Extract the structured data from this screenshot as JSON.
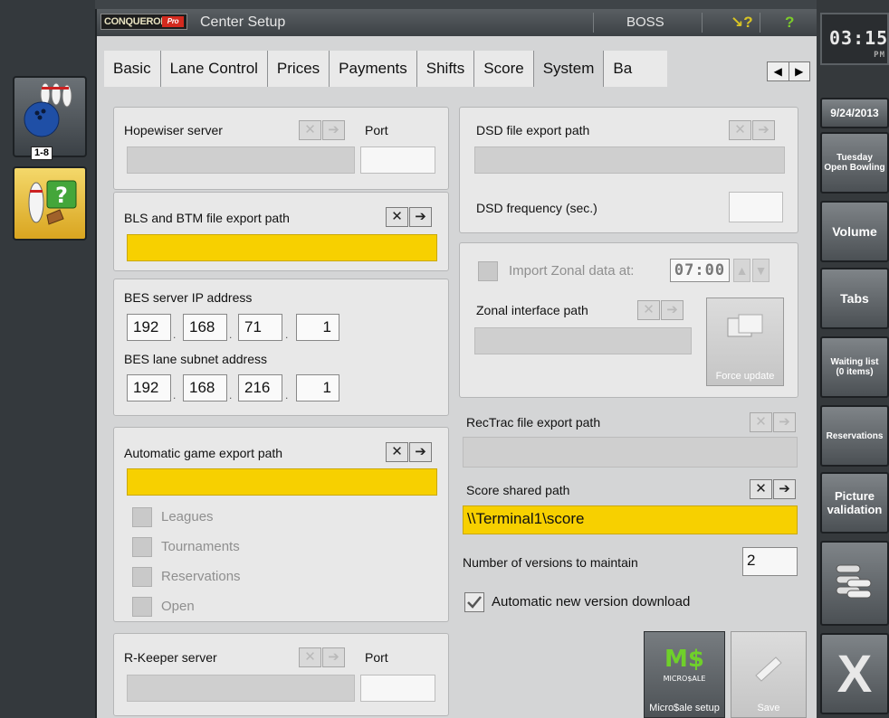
{
  "left": {
    "lanes_badge": "1-8"
  },
  "titlebar": {
    "brand": "CONQUEROR",
    "brand_pro": "Pro",
    "title": "Center Setup",
    "user": "BOSS",
    "icons": [
      "help-pointer-icon",
      "help-icon"
    ]
  },
  "tabs": [
    "Basic",
    "Lane Control",
    "Prices",
    "Payments",
    "Shifts",
    "Score",
    "System",
    "Ba"
  ],
  "tab_scroll": {
    "prev": "◀",
    "next": "▶"
  },
  "hopewiser": {
    "label": "Hopewiser server",
    "port_label": "Port",
    "server": "",
    "port": ""
  },
  "bls": {
    "label": "BLS and BTM file export path",
    "value": ""
  },
  "bes": {
    "ip_label": "BES server IP address",
    "ip": [
      "192",
      "168",
      "71",
      "1"
    ],
    "subnet_label": "BES lane subnet address",
    "subnet": [
      "192",
      "168",
      "216",
      "1"
    ]
  },
  "auto_export": {
    "label": "Automatic game export path",
    "value": "",
    "options": [
      "Leagues",
      "Tournaments",
      "Reservations",
      "Open"
    ]
  },
  "rkeeper": {
    "label": "R-Keeper server",
    "port_label": "Port",
    "server": "",
    "port": ""
  },
  "dsd": {
    "path_label": "DSD file export path",
    "path": "",
    "freq_label": "DSD frequency (sec.)",
    "freq": ""
  },
  "zonal": {
    "import_label": "Import Zonal data at:",
    "time": "07:00",
    "path_label": "Zonal interface path",
    "path": "",
    "force_update": "Force update"
  },
  "rectrac": {
    "label": "RecTrac file export path",
    "value": ""
  },
  "score_shared": {
    "label": "Score shared path",
    "value": "\\\\Terminal1\\score"
  },
  "versions": {
    "label": "Number of versions to maintain",
    "value": "2"
  },
  "auto_download": {
    "label": "Automatic new version download",
    "checked": true
  },
  "bottom_buttons": {
    "microsale": "Micro$ale setup",
    "save": "Save"
  },
  "right": {
    "time": "03:15",
    "ampm": "PM",
    "date": "9/24/2013",
    "day": "Tuesday",
    "mode": "Open Bowling",
    "volume": "Volume",
    "tabs": "Tabs",
    "waiting": "Waiting list",
    "waiting_count": "(0 items)",
    "reservations": "Reservations",
    "picture": "Picture validation"
  }
}
